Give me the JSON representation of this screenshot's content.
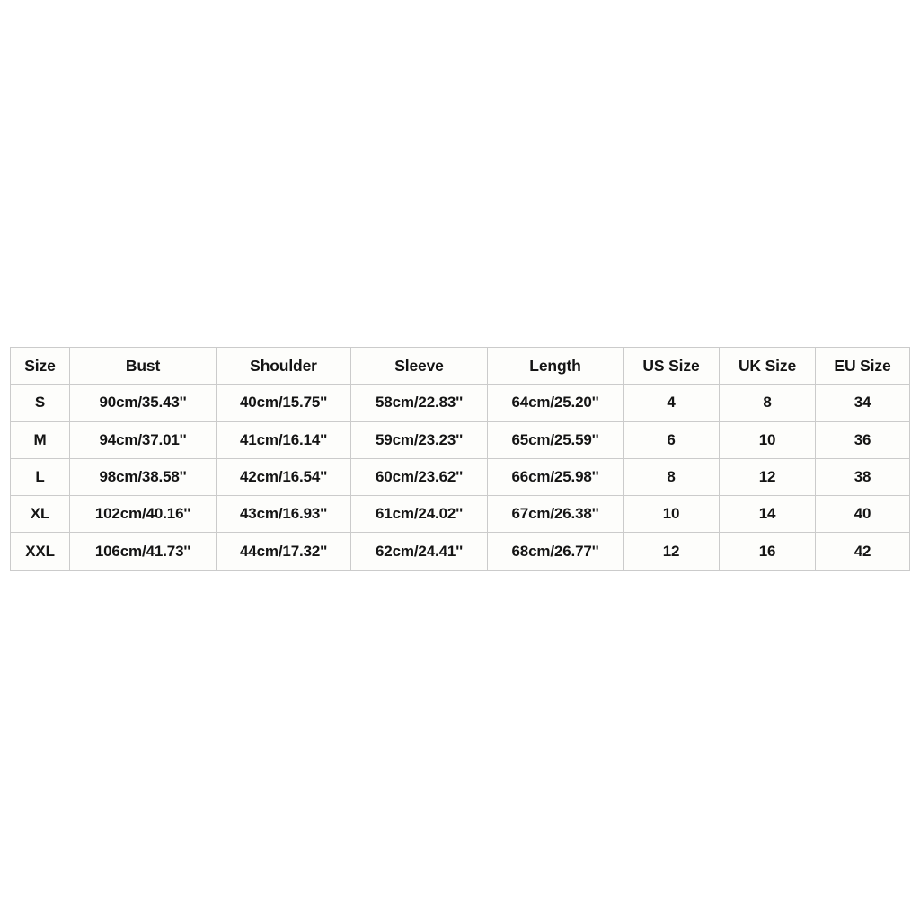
{
  "page": {
    "background_color": "#ffffff",
    "cell_background_color": "#fdfdfb",
    "border_color": "#cbcbcb",
    "text_color": "#141414"
  },
  "size_chart": {
    "title": "",
    "columns": [
      "Size",
      "Bust",
      "Shoulder",
      "Sleeve",
      "Length",
      "US Size",
      "UK Size",
      "EU Size"
    ],
    "rows": [
      {
        "size": "S",
        "bust": "90cm/35.43''",
        "shoulder": "40cm/15.75''",
        "sleeve": "58cm/22.83''",
        "length": "64cm/25.20''",
        "us_size": "4",
        "uk_size": "8",
        "eu_size": "34"
      },
      {
        "size": "M",
        "bust": "94cm/37.01''",
        "shoulder": "41cm/16.14''",
        "sleeve": "59cm/23.23''",
        "length": "65cm/25.59''",
        "us_size": "6",
        "uk_size": "10",
        "eu_size": "36"
      },
      {
        "size": "L",
        "bust": "98cm/38.58''",
        "shoulder": "42cm/16.54''",
        "sleeve": "60cm/23.62''",
        "length": "66cm/25.98''",
        "us_size": "8",
        "uk_size": "12",
        "eu_size": "38"
      },
      {
        "size": "XL",
        "bust": "102cm/40.16''",
        "shoulder": "43cm/16.93''",
        "sleeve": "61cm/24.02''",
        "length": "67cm/26.38''",
        "us_size": "10",
        "uk_size": "14",
        "eu_size": "40"
      },
      {
        "size": "XXL",
        "bust": "106cm/41.73''",
        "shoulder": "44cm/17.32''",
        "sleeve": "62cm/24.41''",
        "length": "68cm/26.77''",
        "us_size": "12",
        "uk_size": "16",
        "eu_size": "42"
      }
    ]
  }
}
